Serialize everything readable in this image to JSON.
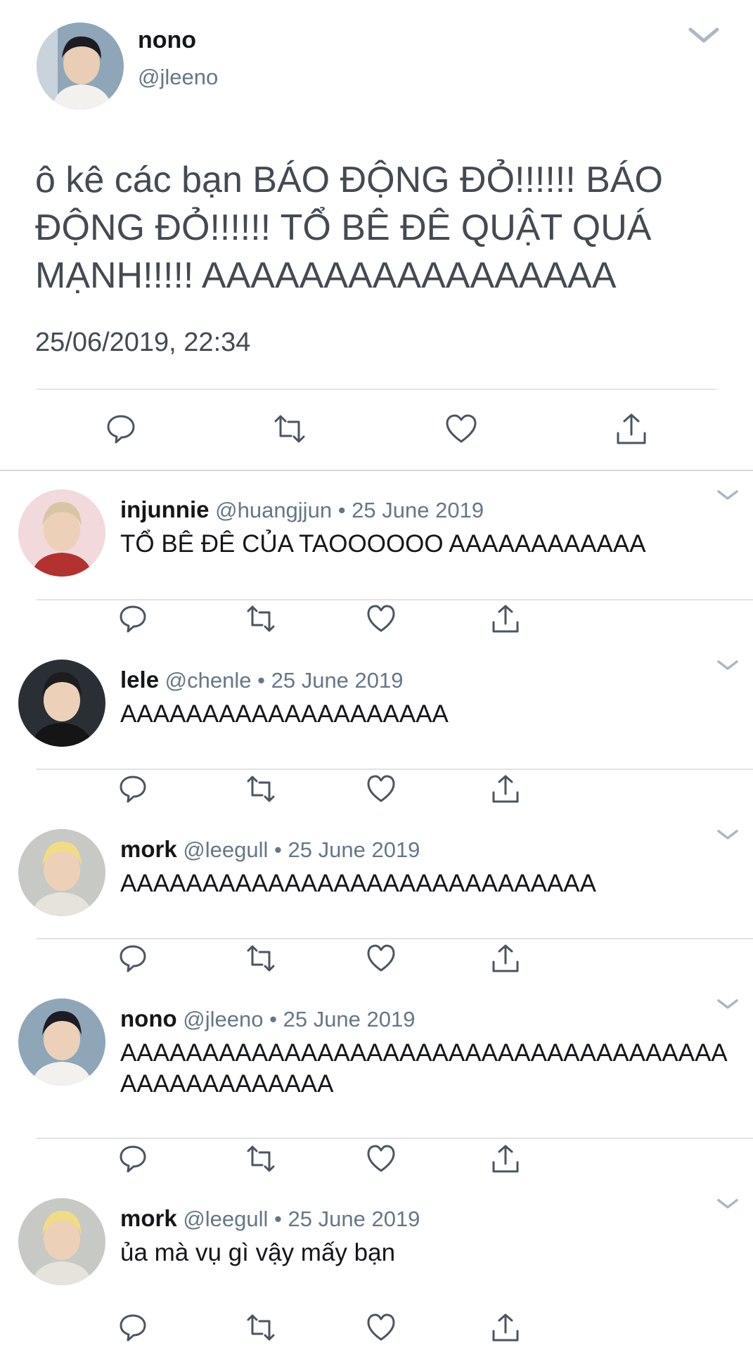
{
  "main_tweet": {
    "name": "nono",
    "handle": "@jleeno",
    "text": "ô kê các bạn BÁO ĐỘNG ĐỎ!!!!!! BÁO ĐỘNG ĐỎ!!!!!! TỔ BÊ ĐÊ QUẬT QUÁ MẠNH!!!!! AAAAAAAAAAAAAAAAA",
    "timestamp": "25/06/2019, 22:34"
  },
  "replies": [
    {
      "name": "injunnie",
      "handle": "@huangjjun",
      "separator": "•",
      "date": "25 June 2019",
      "text": "TỔ BÊ ĐÊ CỦA TAOOOOOO AAAAAAAAAAAA"
    },
    {
      "name": "lele",
      "handle": "@chenle",
      "separator": "•",
      "date": "25 June 2019",
      "text": "AAAAAAAAAAAAAAAAAAAA"
    },
    {
      "name": "mork",
      "handle": "@leegull",
      "separator": "•",
      "date": "25 June 2019",
      "text": "AAAAAAAAAAAAAAAAAAAAAAAAAAAAA"
    },
    {
      "name": "nono",
      "handle": "@jleeno",
      "separator": "•",
      "date": "25 June 2019",
      "text": "AAAAAAAAAAAAAAAAAAAAAAAAAAAAAAAAAAAAAAAAAAAAAAAAAA"
    },
    {
      "name": "mork",
      "handle": "@leegull",
      "separator": "•",
      "date": "25 June 2019",
      "text": "ủa mà vụ gì vậy mấy bạn"
    }
  ],
  "icons": {
    "reply": "reply-icon",
    "retweet": "retweet-icon",
    "like": "heart-icon",
    "share": "share-icon",
    "more": "chevron-down-icon"
  },
  "colors": {
    "name": "#14171a",
    "secondary": "#657786",
    "icon": "#657786",
    "divider": "#dfe3e7"
  }
}
